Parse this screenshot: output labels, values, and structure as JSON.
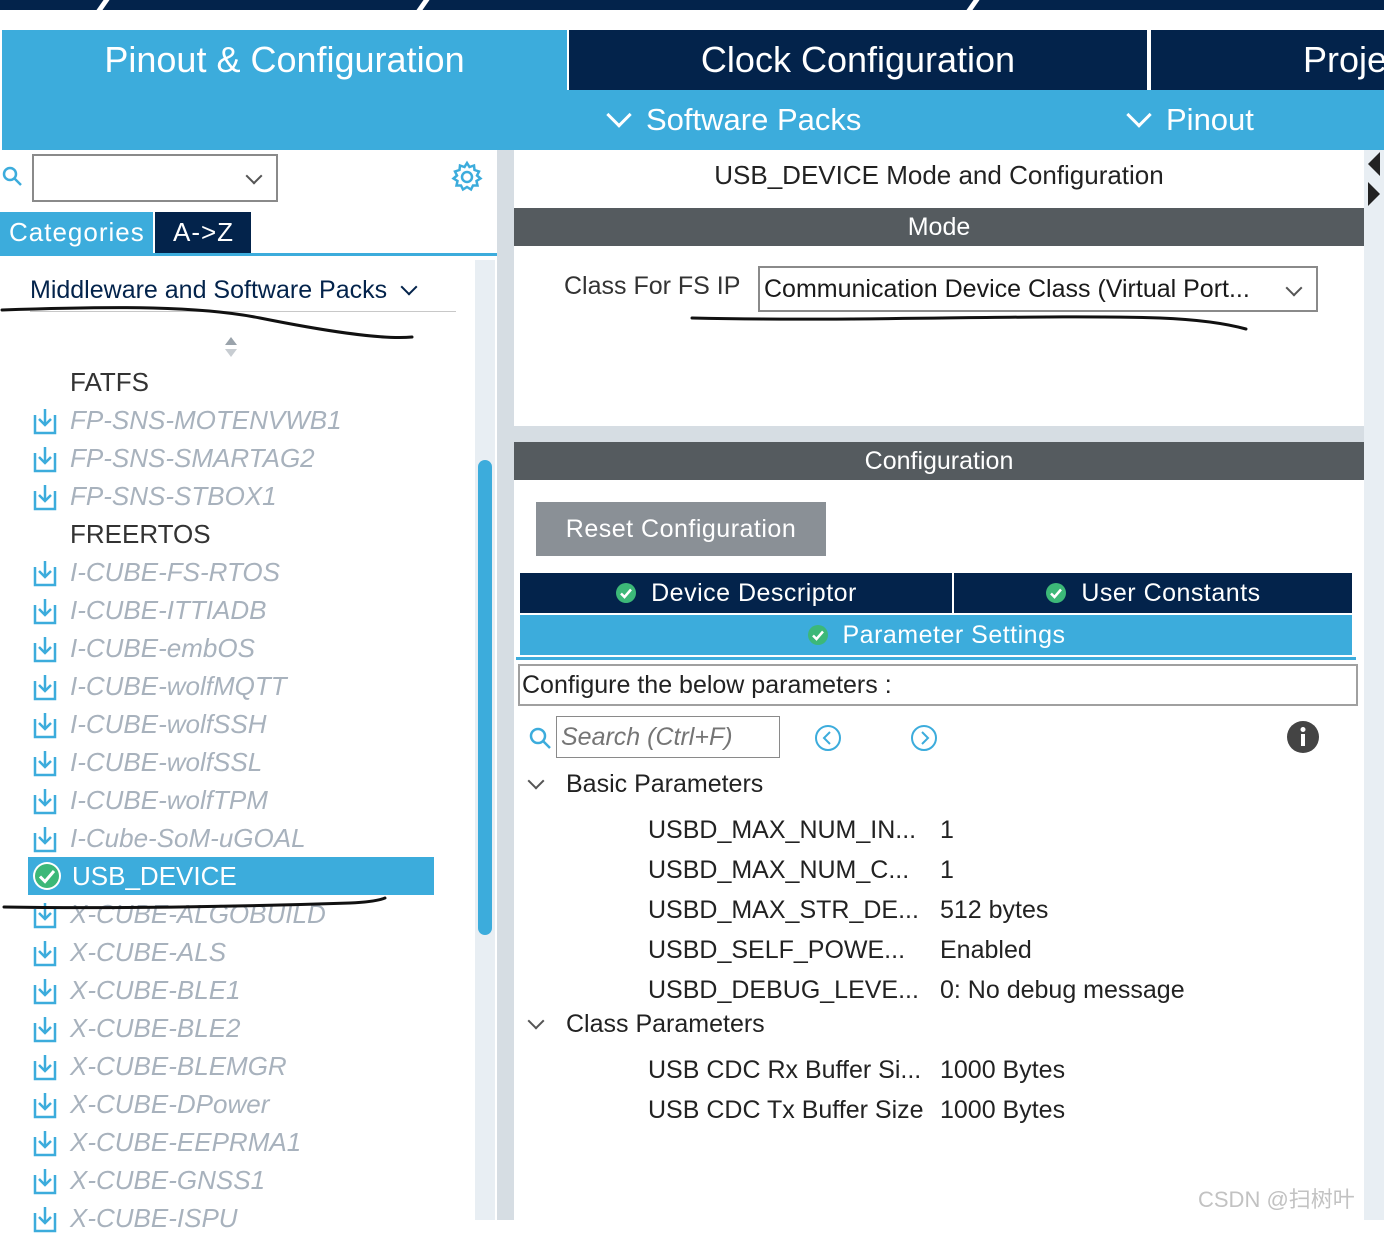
{
  "tabs": {
    "pinout": "Pinout & Configuration",
    "clock": "Clock Configuration",
    "project": "Proje"
  },
  "subtabs": {
    "software_packs": "Software Packs",
    "pinout": "Pinout"
  },
  "left": {
    "categories_tab": "Categories",
    "az_tab": "A->Z",
    "middleware_group": "Middleware and Software Packs",
    "items": [
      {
        "label": "FATFS",
        "state": "plain"
      },
      {
        "label": "FP-SNS-MOTENVWB1",
        "state": "dim"
      },
      {
        "label": "FP-SNS-SMARTAG2",
        "state": "dim"
      },
      {
        "label": "FP-SNS-STBOX1",
        "state": "dim"
      },
      {
        "label": "FREERTOS",
        "state": "plain"
      },
      {
        "label": "I-CUBE-FS-RTOS",
        "state": "dim"
      },
      {
        "label": "I-CUBE-ITTIADB",
        "state": "dim"
      },
      {
        "label": "I-CUBE-embOS",
        "state": "dim"
      },
      {
        "label": "I-CUBE-wolfMQTT",
        "state": "dim"
      },
      {
        "label": "I-CUBE-wolfSSH",
        "state": "dim"
      },
      {
        "label": "I-CUBE-wolfSSL",
        "state": "dim"
      },
      {
        "label": "I-CUBE-wolfTPM",
        "state": "dim"
      },
      {
        "label": "I-Cube-SoM-uGOAL",
        "state": "dim"
      },
      {
        "label": "USB_DEVICE",
        "state": "selected"
      },
      {
        "label": "X-CUBE-ALGOBUILD",
        "state": "dim"
      },
      {
        "label": "X-CUBE-ALS",
        "state": "dim"
      },
      {
        "label": "X-CUBE-BLE1",
        "state": "dim"
      },
      {
        "label": "X-CUBE-BLE2",
        "state": "dim"
      },
      {
        "label": "X-CUBE-BLEMGR",
        "state": "dim"
      },
      {
        "label": "X-CUBE-DPower",
        "state": "dim"
      },
      {
        "label": "X-CUBE-EEPRMA1",
        "state": "dim"
      },
      {
        "label": "X-CUBE-GNSS1",
        "state": "dim"
      },
      {
        "label": "X-CUBE-ISPU",
        "state": "dim"
      }
    ]
  },
  "right": {
    "title": "USB_DEVICE Mode and Configuration",
    "mode_header": "Mode",
    "class_label": "Class For FS IP",
    "class_value": "Communication Device Class (Virtual Port...",
    "config_header": "Configuration",
    "reset_button": "Reset Configuration",
    "tab_device_descriptor": "Device Descriptor",
    "tab_user_constants": "User Constants",
    "tab_parameter_settings": "Parameter Settings",
    "configure_text": "Configure the below parameters :",
    "search_placeholder": "Search (Ctrl+F)",
    "groups": [
      {
        "name": "Basic Parameters",
        "params": [
          {
            "name": "USBD_MAX_NUM_IN...",
            "value": "1"
          },
          {
            "name": "USBD_MAX_NUM_C...",
            "value": "1"
          },
          {
            "name": "USBD_MAX_STR_DE...",
            "value": "512 bytes"
          },
          {
            "name": "USBD_SELF_POWE...",
            "value": "Enabled"
          },
          {
            "name": "USBD_DEBUG_LEVE...",
            "value": "0: No debug message"
          }
        ]
      },
      {
        "name": "Class Parameters",
        "params": [
          {
            "name": "USB CDC Rx Buffer Si...",
            "value": "1000 Bytes"
          },
          {
            "name": "USB CDC Tx Buffer Size",
            "value": "1000 Bytes"
          }
        ]
      }
    ]
  },
  "watermark": "CSDN @扫树叶",
  "colors": {
    "accent": "#3cacdc",
    "navy": "#03234b",
    "header_gray": "#555b5f",
    "ok_green": "#3cb878"
  }
}
